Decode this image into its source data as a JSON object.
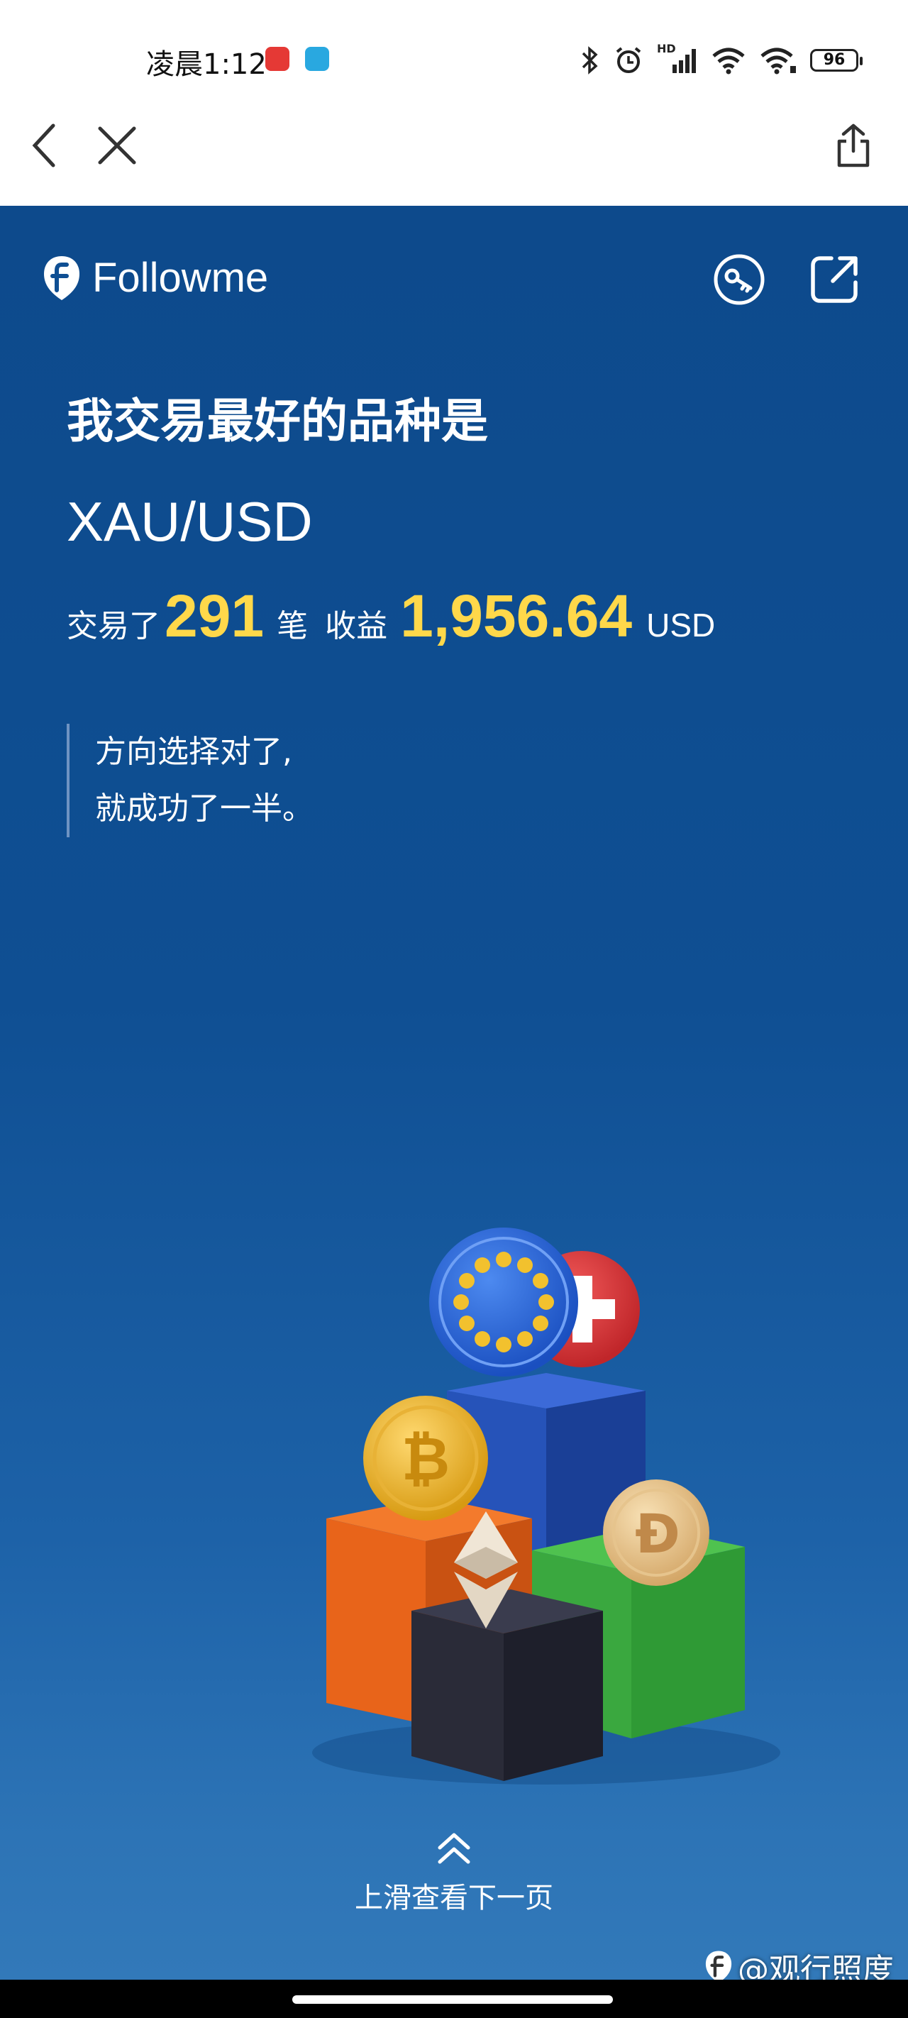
{
  "status_bar": {
    "time": "凌晨1:12",
    "battery": "96",
    "network_label": "HD"
  },
  "nav": {
    "back_icon": "chevron-left-icon",
    "close_icon": "close-icon",
    "share_icon": "share-icon"
  },
  "brand": {
    "name": "Followme",
    "logo_icon": "followme-logo-icon"
  },
  "header_icons": [
    "key-icon",
    "external-link-icon"
  ],
  "report": {
    "headline": "我交易最好的品种是",
    "symbol": "XAU/USD",
    "traded_prefix": "交易了",
    "trade_count": "291",
    "trade_unit": "笔",
    "profit_label": "收益",
    "profit_value": "1,956.64",
    "currency": "USD"
  },
  "quote": {
    "line1": "方向选择对了,",
    "line2": "就成功了一半。"
  },
  "swipe": {
    "label": "上滑查看下一页",
    "icon": "double-chevron-up-icon"
  },
  "watermark": {
    "text": "@观行照度"
  },
  "colors": {
    "background": "#0f4f93",
    "accent_yellow": "#ffd84a",
    "text": "#ffffff"
  }
}
